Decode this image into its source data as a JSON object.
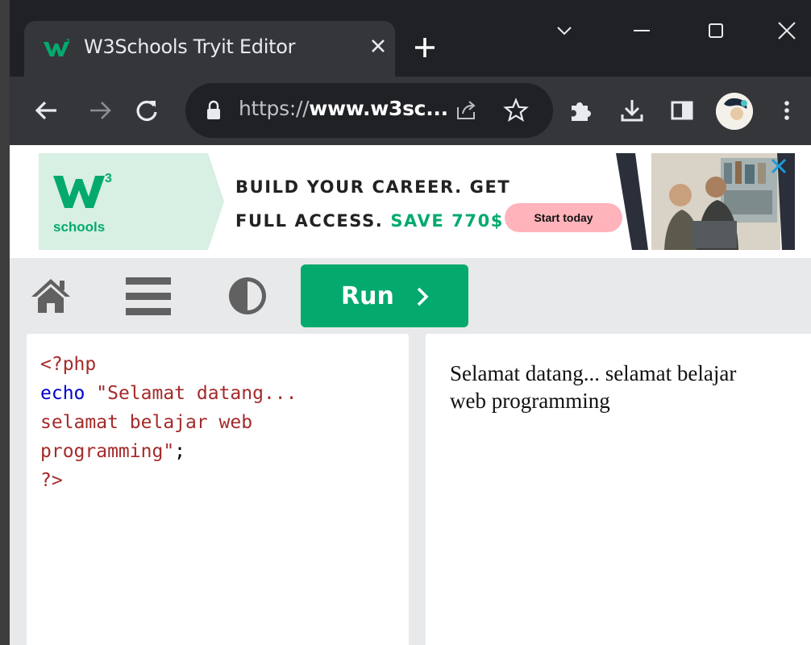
{
  "tab": {
    "title": "W3Schools Tryit Editor",
    "close_icon": "close-icon",
    "new_tab_icon": "plus-icon"
  },
  "window_controls": [
    "chevron-down-icon",
    "minimize-icon",
    "maximize-icon",
    "close-icon"
  ],
  "toolbar": {
    "icons": [
      "back-arrow-icon",
      "forward-arrow-icon",
      "reload-icon",
      "lock-icon",
      "share-icon",
      "star-icon",
      "extensions-puzzle-icon",
      "download-icon",
      "side-panel-icon",
      "profile-avatar",
      "more-vertical-icon"
    ],
    "url_prefix": "https://",
    "url_host": "www.w3sc..."
  },
  "ad": {
    "logo_text": "schools",
    "line1": "BUILD YOUR CAREER. GET",
    "line2_prefix": "FULL ACCESS.",
    "line2_accent": "SAVE 770$",
    "cta": "Start today",
    "accent_color": "#04aa6d",
    "cta_color": "#ffb3bb"
  },
  "editor_toolbar": {
    "icons": [
      "home-icon",
      "menu-icon",
      "contrast-icon"
    ],
    "run_label": "Run",
    "run_color": "#04aa6d"
  },
  "code": {
    "line1": "<?php",
    "line2_keyword": "echo",
    "line2_string": "\"Selamat datang...",
    "line3_string": "selamat belajar web",
    "line4_string": "programming\"",
    "line4_punct": ";",
    "line5": "?>"
  },
  "result": {
    "text": "Selamat datang... selamat belajar web programming"
  }
}
